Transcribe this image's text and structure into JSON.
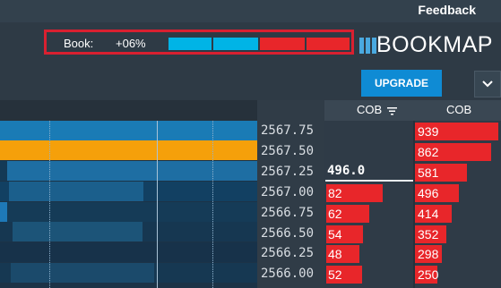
{
  "topbar": {
    "feedback_label": "Feedback"
  },
  "book": {
    "label": "Book:",
    "imbalance": "+06%",
    "bid_share": 0.53
  },
  "brand": {
    "logo_text": "BOOKMAP",
    "accent": "#4aa9e0"
  },
  "upgrade_label": "UPGRADE",
  "columns": {
    "cob_left": "COB",
    "cob_right": "COB"
  },
  "trade": {
    "value": "496.0"
  },
  "ladder": [
    {
      "price": "2567.75",
      "left": "",
      "right": "939"
    },
    {
      "price": "2567.50",
      "left": "",
      "right": "862"
    },
    {
      "price": "2567.25",
      "left": "",
      "right": "581"
    },
    {
      "price": "2567.00",
      "left": "82",
      "right": "496"
    },
    {
      "price": "2566.75",
      "left": "62",
      "right": "414"
    },
    {
      "price": "2566.50",
      "left": "54",
      "right": "352"
    },
    {
      "price": "2566.25",
      "left": "48",
      "right": "298"
    },
    {
      "price": "2566.00",
      "left": "52",
      "right": "250"
    }
  ],
  "colors": {
    "bid": "#00b4e6",
    "ask": "#e8262a",
    "highlight": "#f5a00a"
  }
}
